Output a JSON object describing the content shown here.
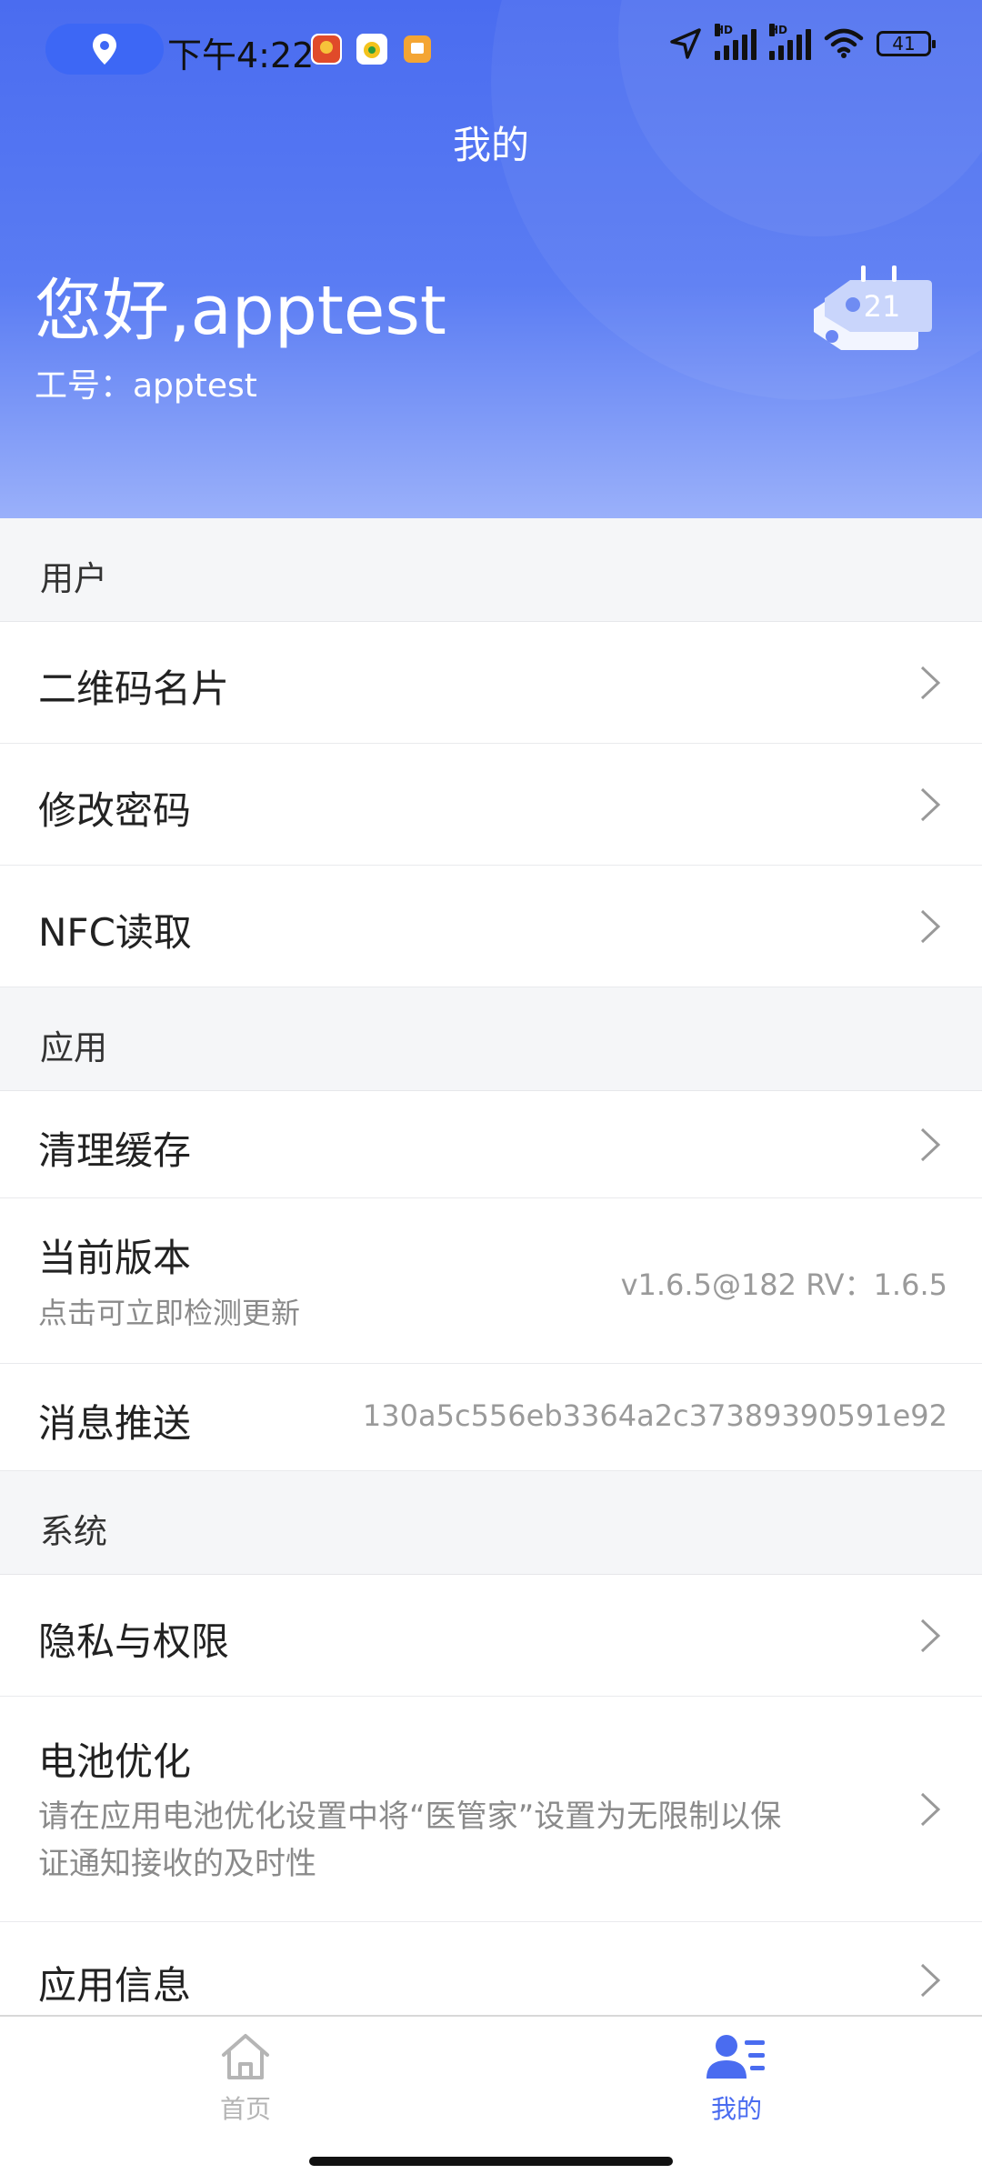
{
  "status_bar": {
    "time": "下午4:22",
    "battery": "41",
    "hd1": "HD",
    "hd2": "HD"
  },
  "header": {
    "nav_title": "我的",
    "greeting": "您好,apptest",
    "employee_id": "工号：apptest",
    "badge_number": "21"
  },
  "sections": {
    "user": {
      "label": "用户",
      "items": {
        "qr": "二维码名片",
        "password": "修改密码",
        "nfc": "NFC读取"
      }
    },
    "app": {
      "label": "应用",
      "items": {
        "clear_cache": "清理缓存",
        "version_title": "当前版本",
        "version_sub": "点击可立即检测更新",
        "version_value": "v1.6.5@182 RV：1.6.5",
        "push_title": "消息推送",
        "push_value": "130a5c556eb3364a2c37389390591e92"
      }
    },
    "system": {
      "label": "系统",
      "items": {
        "privacy": "隐私与权限",
        "battery_title": "电池优化",
        "battery_sub_line1": "请在应用电池优化设置中将“医管家”设置为无限制以保",
        "battery_sub_line2": "证通知接收的及时性",
        "app_info": "应用信息"
      }
    }
  },
  "tabbar": {
    "home": "首页",
    "mine": "我的"
  },
  "colors": {
    "accent": "#4a6cf0",
    "tab_active": "#4a6cf0",
    "tab_inactive": "#b5b5b5"
  }
}
